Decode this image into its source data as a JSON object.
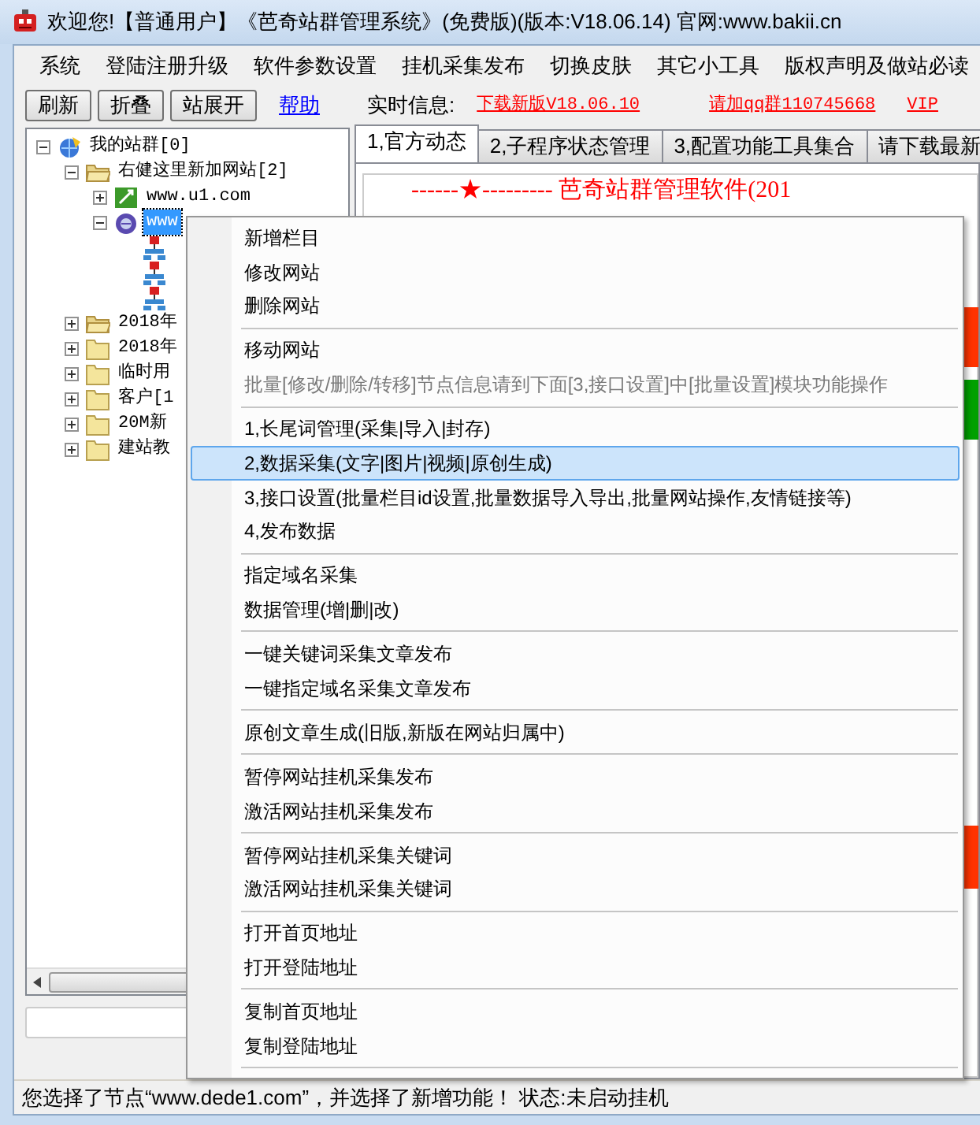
{
  "window": {
    "title": "欢迎您!【普通用户】《芭奇站群管理系统》(免费版)(版本:V18.06.14) 官网:www.bakii.cn"
  },
  "menu_bar": [
    "系统",
    "登陆注册升级",
    "软件参数设置",
    "挂机采集发布",
    "切换皮肤",
    "其它小工具",
    "版权声明及做站必读"
  ],
  "toolbar": {
    "buttons": [
      "刷新",
      "折叠",
      "站展开"
    ],
    "help_link": "帮助"
  },
  "info_bar": {
    "label": "实时信息:",
    "links": [
      "下载新版V18.06.10",
      "请加qq群110745668",
      "VIP"
    ]
  },
  "tree": [
    {
      "label": "我的站群[0]",
      "kind": "group",
      "expanded": true,
      "selected": false,
      "children": [
        {
          "label": "右健这里新加网站[2]",
          "kind": "folder-open",
          "expanded": true,
          "selected": false,
          "children": [
            {
              "label": "www.u1.com",
              "kind": "site",
              "expanded": false,
              "selected": false
            },
            {
              "label": "www",
              "kind": "globe",
              "expanded": true,
              "selected": true,
              "children": [
                {
                  "kind": "node"
                },
                {
                  "kind": "node"
                },
                {
                  "kind": "node"
                }
              ]
            }
          ]
        },
        {
          "label": "2018年",
          "kind": "folder-open",
          "expanded": false,
          "selected": false
        },
        {
          "label": "2018年",
          "kind": "folder",
          "expanded": false,
          "selected": false
        },
        {
          "label": "临时用",
          "kind": "folder",
          "expanded": false,
          "selected": false
        },
        {
          "label": "客户[1",
          "kind": "folder",
          "expanded": false,
          "selected": false
        },
        {
          "label": "20M新",
          "kind": "folder",
          "expanded": false,
          "selected": false
        },
        {
          "label": "建站教",
          "kind": "folder",
          "expanded": false,
          "selected": false
        }
      ]
    }
  ],
  "tabs": [
    {
      "label": "1,官方动态",
      "selected": true
    },
    {
      "label": "2,子程序状态管理",
      "selected": false
    },
    {
      "label": "3,配置功能工具集合",
      "selected": false
    },
    {
      "label": "请下载最新",
      "selected": false
    }
  ],
  "content": {
    "headline": "------★---------  芭奇站群管理软件(201"
  },
  "context_menu": {
    "groups": [
      [
        {
          "label": "新增栏目",
          "selected": false,
          "disabled": false
        },
        {
          "label": "修改网站",
          "selected": false,
          "disabled": false
        },
        {
          "label": "删除网站",
          "selected": false,
          "disabled": false
        }
      ],
      [
        {
          "label": "移动网站",
          "selected": false,
          "disabled": false
        },
        {
          "label": "批量[修改/删除/转移]节点信息请到下面[3,接口设置]中[批量设置]模块功能操作",
          "selected": false,
          "disabled": true
        }
      ],
      [
        {
          "label": "1,长尾词管理(采集|导入|封存)",
          "selected": false,
          "disabled": false
        },
        {
          "label": "2,数据采集(文字|图片|视频|原创生成)",
          "selected": true,
          "disabled": false
        },
        {
          "label": "3,接口设置(批量栏目id设置,批量数据导入导出,批量网站操作,友情链接等)",
          "selected": false,
          "disabled": false
        },
        {
          "label": "4,发布数据",
          "selected": false,
          "disabled": false
        }
      ],
      [
        {
          "label": "指定域名采集",
          "selected": false,
          "disabled": false
        },
        {
          "label": "数据管理(增|删|改)",
          "selected": false,
          "disabled": false
        }
      ],
      [
        {
          "label": "一键关键词采集文章发布",
          "selected": false,
          "disabled": false
        },
        {
          "label": "一键指定域名采集文章发布",
          "selected": false,
          "disabled": false
        }
      ],
      [
        {
          "label": "原创文章生成(旧版,新版在网站归属中)",
          "selected": false,
          "disabled": false
        }
      ],
      [
        {
          "label": "暂停网站挂机采集发布",
          "selected": false,
          "disabled": false
        },
        {
          "label": "激活网站挂机采集发布",
          "selected": false,
          "disabled": false
        }
      ],
      [
        {
          "label": "暂停网站挂机采集关键词",
          "selected": false,
          "disabled": false
        },
        {
          "label": "激活网站挂机采集关键词",
          "selected": false,
          "disabled": false
        }
      ],
      [
        {
          "label": "打开首页地址",
          "selected": false,
          "disabled": false
        },
        {
          "label": "打开登陆地址",
          "selected": false,
          "disabled": false
        }
      ],
      [
        {
          "label": "复制首页地址",
          "selected": false,
          "disabled": false
        },
        {
          "label": "复制登陆地址",
          "selected": false,
          "disabled": false
        }
      ]
    ]
  },
  "status_bar": "您选择了节点“www.dede1.com”，并选择了新增功能！  状态:未启动挂机"
}
